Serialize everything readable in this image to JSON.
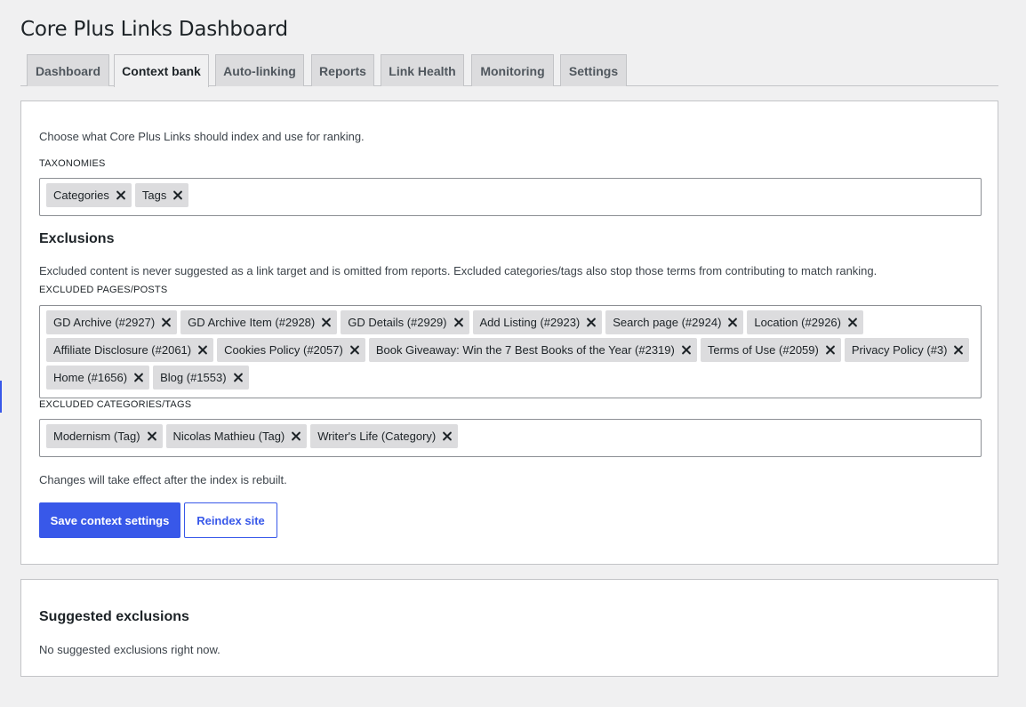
{
  "page": {
    "title": "Core Plus Links Dashboard"
  },
  "tabs": [
    {
      "label": "Dashboard",
      "active": false
    },
    {
      "label": "Context bank",
      "active": true
    },
    {
      "label": "Auto-linking",
      "active": false
    },
    {
      "label": "Reports",
      "active": false
    },
    {
      "label": "Link Health",
      "active": false
    },
    {
      "label": "Monitoring",
      "active": false
    },
    {
      "label": "Settings",
      "active": false
    }
  ],
  "context": {
    "intro": "Choose what Core Plus Links should index and use for ranking.",
    "taxonomies_label": "TAXONOMIES",
    "taxonomies": [
      "Categories",
      "Tags"
    ],
    "exclusions_heading": "Exclusions",
    "exclusions_desc": "Excluded content is never suggested as a link target and is omitted from reports. Excluded categories/tags also stop those terms from contributing to match ranking.",
    "excluded_pages_label": "EXCLUDED PAGES/POSTS",
    "excluded_pages": [
      "GD Archive (#2927)",
      "GD Archive Item (#2928)",
      "GD Details (#2929)",
      "Add Listing (#2923)",
      "Search page (#2924)",
      "Location (#2926)",
      "Affiliate Disclosure (#2061)",
      "Cookies Policy (#2057)",
      "Book Giveaway: Win the 7 Best Books of the Year (#2319)",
      "Terms of Use (#2059)",
      "Privacy Policy (#3)",
      "Home (#1656)",
      "Blog (#1553)"
    ],
    "excluded_terms_label": "EXCLUDED CATEGORIES/TAGS",
    "excluded_terms": [
      "Modernism (Tag)",
      "Nicolas Mathieu (Tag)",
      "Writer's Life (Category)"
    ],
    "note": "Changes will take effect after the index is rebuilt.",
    "save_label": "Save context settings",
    "reindex_label": "Reindex site"
  },
  "suggested": {
    "heading": "Suggested exclusions",
    "empty_text": "No suggested exclusions right now."
  },
  "colors": {
    "accent": "#3858e9",
    "background": "#f0f0f1",
    "chip": "#dcdcde"
  },
  "icons": {
    "chip_remove": "close-icon"
  }
}
